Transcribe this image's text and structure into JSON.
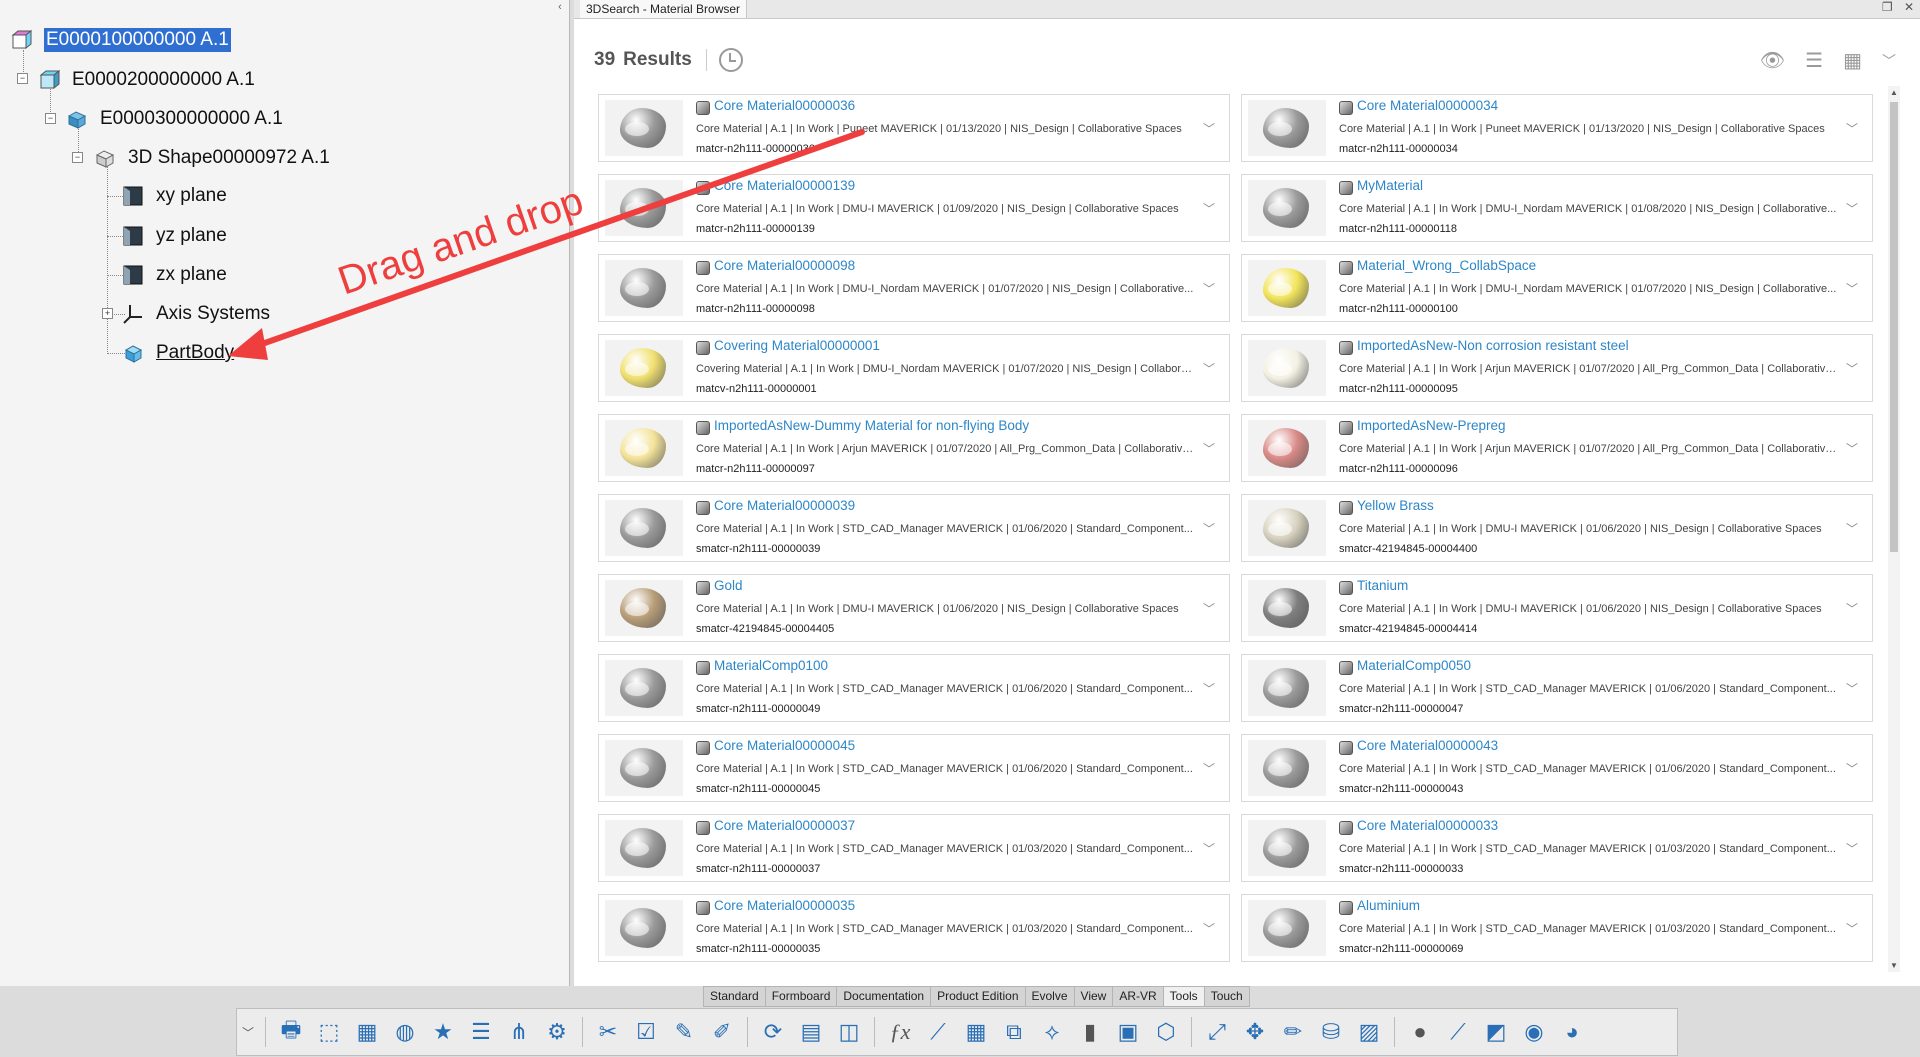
{
  "tree": {
    "nodes": [
      {
        "label": "E0000100000000 A.1",
        "selected": true
      },
      {
        "label": "E0000200000000 A.1"
      },
      {
        "label": "E0000300000000 A.1"
      },
      {
        "label": "3D Shape00000972 A.1"
      },
      {
        "label": "xy plane"
      },
      {
        "label": "yz plane"
      },
      {
        "label": "zx plane"
      },
      {
        "label": "Axis Systems"
      },
      {
        "label": "PartBody"
      }
    ]
  },
  "annotation": {
    "text": "Drag and drop",
    "color": "#ee3e3e"
  },
  "browser": {
    "title": "3DSearch - Material Browser",
    "results_count": "39",
    "results_label": "Results",
    "cards": [
      {
        "title": "Core Material00000036",
        "meta": "Core Material | A.1 | In Work | Puneet MAVERICK | 01/13/2020 | NIS_Design | Collaborative Spaces",
        "id": "matcr-n2h111-00000036",
        "color": "#9a9a9a"
      },
      {
        "title": "Core Material00000034",
        "meta": "Core Material | A.1 | In Work | Puneet MAVERICK | 01/13/2020 | NIS_Design | Collaborative Spaces",
        "id": "matcr-n2h111-00000034",
        "color": "#9a9a9a"
      },
      {
        "title": "Core Material00000139",
        "meta": "Core Material | A.1 | In Work | DMU-I MAVERICK | 01/09/2020 | NIS_Design | Collaborative Spaces",
        "id": "matcr-n2h111-00000139",
        "color": "#9a9a9a"
      },
      {
        "title": "MyMaterial",
        "meta": "Core Material | A.1 | In Work | DMU-I_Nordam MAVERICK | 01/08/2020 | NIS_Design | Collaborative...",
        "id": "matcr-n2h111-00000118",
        "color": "#9a9a9a"
      },
      {
        "title": "Core Material00000098",
        "meta": "Core Material | A.1 | In Work | DMU-I_Nordam MAVERICK | 01/07/2020 | NIS_Design | Collaborative...",
        "id": "matcr-n2h111-00000098",
        "color": "#9a9a9a"
      },
      {
        "title": "Material_Wrong_CollabSpace",
        "meta": "Core Material | A.1 | In Work | DMU-I_Nordam MAVERICK | 01/07/2020 | NIS_Design | Collaborative...",
        "id": "matcr-n2h111-00000100",
        "color": "#f2e45a"
      },
      {
        "title": "Covering Material00000001",
        "meta": "Covering Material | A.1 | In Work | DMU-I_Nordam MAVERICK | 01/07/2020 | NIS_Design | Collabora...",
        "id": "matcv-n2h111-00000001",
        "color": "#f0e070"
      },
      {
        "title": "ImportedAsNew-Non corrosion resistant steel",
        "meta": "Core Material | A.1 | In Work | Arjun MAVERICK | 01/07/2020 | All_Prg_Common_Data | Collaborative...",
        "id": "matcr-n2h111-00000095",
        "color": "#f3f1e4"
      },
      {
        "title": "ImportedAsNew-Dummy Material for non-flying Body",
        "meta": "Core Material | A.1 | In Work | Arjun MAVERICK | 01/07/2020 | All_Prg_Common_Data | Collaborative...",
        "id": "matcr-n2h111-00000097",
        "color": "#f3e39a"
      },
      {
        "title": "ImportedAsNew-Prepreg",
        "meta": "Core Material | A.1 | In Work | Arjun MAVERICK | 01/07/2020 | All_Prg_Common_Data | Collaborative...",
        "id": "matcr-n2h111-00000096",
        "color": "#d98a86"
      },
      {
        "title": "Core Material00000039",
        "meta": "Core Material | A.1 | In Work | STD_CAD_Manager MAVERICK | 01/06/2020 | Standard_Component...",
        "id": "smatcr-n2h111-00000039",
        "color": "#9a9a9a"
      },
      {
        "title": "Yellow Brass",
        "meta": "Core Material | A.1 | In Work | DMU-I MAVERICK | 01/06/2020 | NIS_Design | Collaborative Spaces",
        "id": "smatcr-42194845-00004400",
        "color": "#d7d2bf"
      },
      {
        "title": "Gold",
        "meta": "Core Material | A.1 | In Work | DMU-I MAVERICK | 01/06/2020 | NIS_Design | Collaborative Spaces",
        "id": "smatcr-42194845-00004405",
        "color": "#b89d78"
      },
      {
        "title": "Titanium",
        "meta": "Core Material | A.1 | In Work | DMU-I MAVERICK | 01/06/2020 | NIS_Design | Collaborative Spaces",
        "id": "smatcr-42194845-00004414",
        "color": "#7e7e7e"
      },
      {
        "title": "MaterialComp0100",
        "meta": "Core Material | A.1 | In Work | STD_CAD_Manager MAVERICK | 01/06/2020 | Standard_Component...",
        "id": "smatcr-n2h111-00000049",
        "color": "#9a9a9a"
      },
      {
        "title": "MaterialComp0050",
        "meta": "Core Material | A.1 | In Work | STD_CAD_Manager MAVERICK | 01/06/2020 | Standard_Component...",
        "id": "smatcr-n2h111-00000047",
        "color": "#9a9a9a"
      },
      {
        "title": "Core Material00000045",
        "meta": "Core Material | A.1 | In Work | STD_CAD_Manager MAVERICK | 01/06/2020 | Standard_Component...",
        "id": "smatcr-n2h111-00000045",
        "color": "#9a9a9a"
      },
      {
        "title": "Core Material00000043",
        "meta": "Core Material | A.1 | In Work | STD_CAD_Manager MAVERICK | 01/06/2020 | Standard_Component...",
        "id": "smatcr-n2h111-00000043",
        "color": "#9a9a9a"
      },
      {
        "title": "Core Material00000037",
        "meta": "Core Material | A.1 | In Work | STD_CAD_Manager MAVERICK | 01/03/2020 | Standard_Component...",
        "id": "smatcr-n2h111-00000037",
        "color": "#9a9a9a"
      },
      {
        "title": "Core Material00000033",
        "meta": "Core Material | A.1 | In Work | STD_CAD_Manager MAVERICK | 01/03/2020 | Standard_Component...",
        "id": "smatcr-n2h111-00000033",
        "color": "#9a9a9a"
      },
      {
        "title": "Core Material00000035",
        "meta": "Core Material | A.1 | In Work | STD_CAD_Manager MAVERICK | 01/03/2020 | Standard_Component...",
        "id": "smatcr-n2h111-00000035",
        "color": "#9a9a9a"
      },
      {
        "title": "Aluminium",
        "meta": "Core Material | A.1 | In Work | STD_CAD_Manager MAVERICK | 01/03/2020 | Standard_Component...",
        "id": "smatcr-n2h111-00000069",
        "color": "#9a9a9a"
      }
    ]
  },
  "tabs": [
    {
      "label": "Standard"
    },
    {
      "label": "Formboard"
    },
    {
      "label": "Documentation"
    },
    {
      "label": "Product Edition"
    },
    {
      "label": "Evolve"
    },
    {
      "label": "View"
    },
    {
      "label": "AR-VR"
    },
    {
      "label": "Tools",
      "active": true
    },
    {
      "label": "Touch"
    }
  ],
  "toolbar_icons": [
    "printer-settings-icon",
    "select-icon",
    "calculator-icon",
    "globe-icon",
    "star-icon",
    "list-icon",
    "tree-icon",
    "options-icon",
    "scissors-icon",
    "checklist-icon",
    "edit-icon",
    "pen-icon",
    "refresh-icon",
    "table-icon",
    "package-icon",
    "fx-icon",
    "measure-icon",
    "grid-icon",
    "cube-grid-icon",
    "path-icon",
    "gauge-icon",
    "panel-icon",
    "box-icon",
    "expand-icon",
    "move-icon",
    "pencil-icon",
    "bucket-icon",
    "doc-chart-icon",
    "sphere-icon",
    "dropper-icon",
    "eraser-icon",
    "sphere-add-icon",
    "sphere-blue-icon"
  ]
}
